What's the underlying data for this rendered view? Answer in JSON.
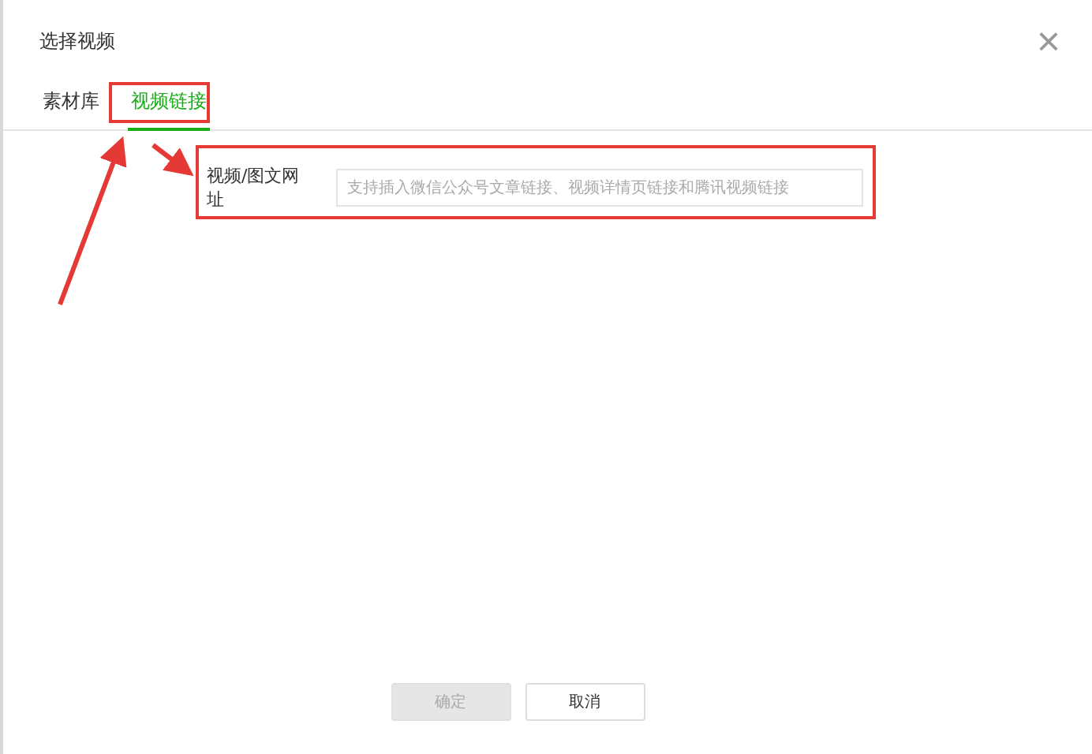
{
  "dialog": {
    "title": "选择视频",
    "close": "×"
  },
  "tabs": [
    {
      "label": "素材库",
      "selected": false
    },
    {
      "label": "视频链接",
      "selected": true
    }
  ],
  "url_field": {
    "label": "视频/图文网址",
    "placeholder": "支持插入微信公众号文章链接、视频详情页链接和腾讯视频链接"
  },
  "buttons": [
    {
      "label": "确定",
      "disabled": true
    },
    {
      "label": "取消",
      "disabled": false
    }
  ]
}
